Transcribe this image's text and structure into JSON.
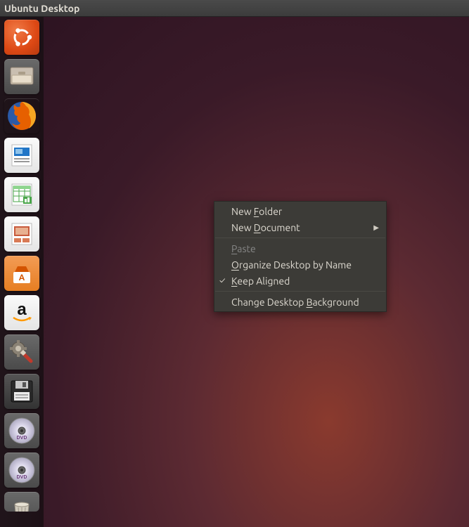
{
  "topPanel": {
    "title": "Ubuntu Desktop"
  },
  "launcher": {
    "items": [
      {
        "name": "dash-home"
      },
      {
        "name": "files"
      },
      {
        "name": "firefox"
      },
      {
        "name": "libreoffice-writer"
      },
      {
        "name": "libreoffice-calc"
      },
      {
        "name": "libreoffice-impress"
      },
      {
        "name": "ubuntu-software"
      },
      {
        "name": "amazon"
      },
      {
        "name": "system-settings"
      },
      {
        "name": "floppy-disk"
      },
      {
        "name": "dvd-1"
      },
      {
        "name": "dvd-2"
      },
      {
        "name": "trash"
      }
    ]
  },
  "contextMenu": {
    "items": [
      {
        "pre": "New ",
        "accel": "F",
        "post": "older",
        "submenu": false,
        "disabled": false,
        "checked": false
      },
      {
        "pre": "New ",
        "accel": "D",
        "post": "ocument",
        "submenu": true,
        "disabled": false,
        "checked": false
      },
      {
        "sep": true
      },
      {
        "pre": "",
        "accel": "P",
        "post": "aste",
        "submenu": false,
        "disabled": true,
        "checked": false
      },
      {
        "pre": "",
        "accel": "O",
        "post": "rganize Desktop by Name",
        "submenu": false,
        "disabled": false,
        "checked": false
      },
      {
        "pre": "",
        "accel": "K",
        "post": "eep Aligned",
        "submenu": false,
        "disabled": false,
        "checked": true
      },
      {
        "sep": true
      },
      {
        "pre": "Change Desktop ",
        "accel": "B",
        "post": "ackground",
        "submenu": false,
        "disabled": false,
        "checked": false
      }
    ]
  }
}
